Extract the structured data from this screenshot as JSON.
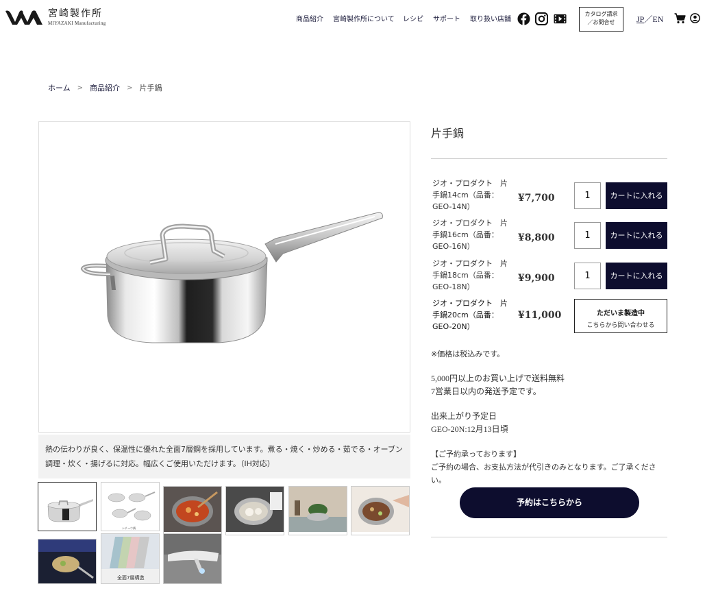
{
  "header": {
    "logo_jp": "宮崎製作所",
    "logo_en": "MIYAZAKI Manufacturing",
    "nav": [
      "商品紹介",
      "宮崎製作所について",
      "レシピ",
      "サポート",
      "取り扱い店舗"
    ],
    "catalog_line1": "カタログ請求",
    "catalog_line2": "／お問合せ",
    "lang_jp": "JP",
    "lang_sep": "／",
    "lang_en": "EN"
  },
  "breadcrumb": {
    "home": "ホーム",
    "products": "商品紹介",
    "current": "片手鍋",
    "separator": ">"
  },
  "product": {
    "title": "片手鍋",
    "caption": "熱の伝わりが良く、保温性に優れた全面7層鋼を採用しています。煮る・焼く・炒める・茹でる・オーブン調理・炊く・揚げるに対応。幅広くご使用いただけます。（IH対応）",
    "thumb_labels": [
      "シチュウ鍋",
      "全面7層構造"
    ]
  },
  "variants": [
    {
      "name": "ジオ・プロダクト　片手鍋14cm（品番：GEO-14N）",
      "price": "¥7,700",
      "qty": "1",
      "button": "カートに入れる"
    },
    {
      "name": "ジオ・プロダクト　片手鍋16cm（品番：GEO-16N）",
      "price": "¥8,800",
      "qty": "1",
      "button": "カートに入れる"
    },
    {
      "name": "ジオ・プロダクト　片手鍋18cm（品番：GEO-18N）",
      "price": "¥9,900",
      "qty": "1",
      "button": "カートに入れる"
    },
    {
      "name": "ジオ・プロダクト　片手鍋20cm（品番：GEO-20N）",
      "price": "¥11,000",
      "status_line1": "ただいま製造中",
      "status_line2": "こちらから問い合わせる"
    }
  ],
  "notes": {
    "tax": "※価格は税込みです。",
    "shipping1": "5,000円以上のお買い上げで送料無料",
    "shipping2": "7営業日以内の発送予定です。",
    "ready_label": "出来上がり予定日",
    "ready_date": "GEO-20N:12月13日頃",
    "reserve_heading": "【ご予約承っております】",
    "reserve_text": "ご予約の場合、お支払方法が代引きのみとなります。ご了承ください。"
  },
  "reserve_button": "予約はこちらから",
  "colors": {
    "navy": "#0d0d2e",
    "border": "#cccccc"
  }
}
